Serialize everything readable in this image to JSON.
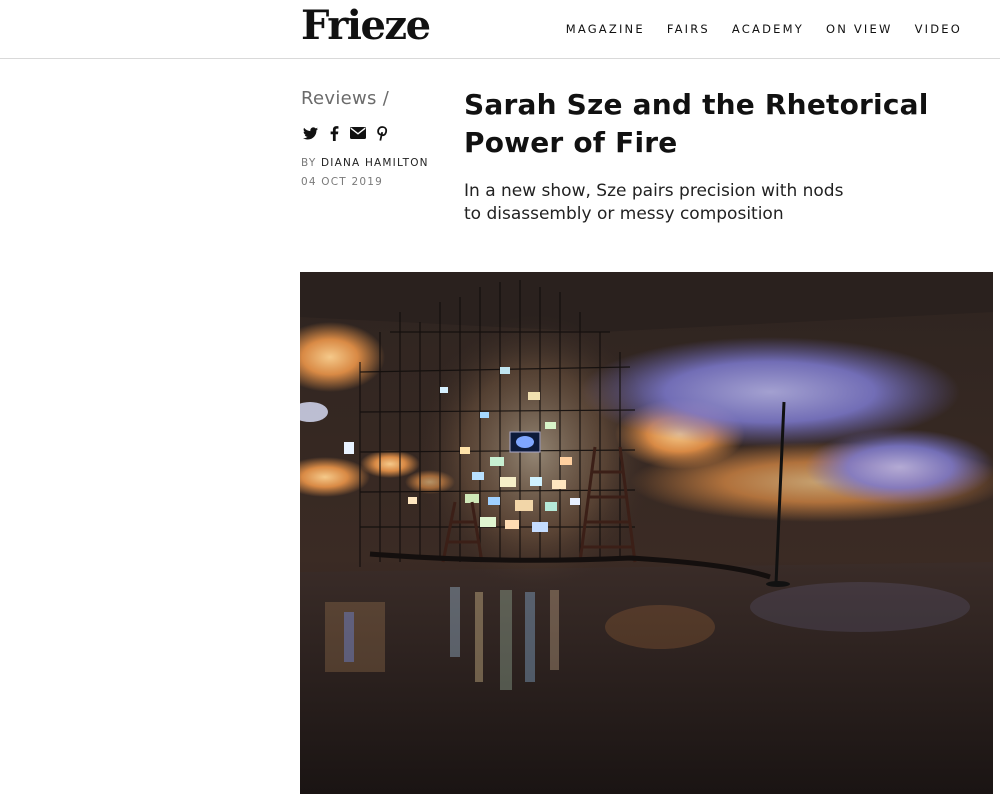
{
  "header": {
    "logo": "Frieze",
    "nav": [
      "MAGAZINE",
      "FAIRS",
      "ACADEMY",
      "ON VIEW",
      "VIDEO"
    ]
  },
  "article": {
    "category": "Reviews /",
    "share_icons": [
      "twitter-icon",
      "facebook-icon",
      "email-icon",
      "pinterest-icon"
    ],
    "byline_prefix": "BY",
    "author": "DIANA HAMILTON",
    "date": "04 OCT 2019",
    "title": "Sarah Sze and the Rhetorical Power of Fire",
    "standfirst": "In a new show, Sze pairs precision with nods to disassembly or messy composition"
  },
  "colors": {
    "text": "#111111",
    "muted": "#6b6b6b",
    "divider": "#d9d9d9",
    "hero_dark": "#1d1715",
    "projection_orange": "#e8a35a",
    "projection_blue": "#8f93d8"
  }
}
